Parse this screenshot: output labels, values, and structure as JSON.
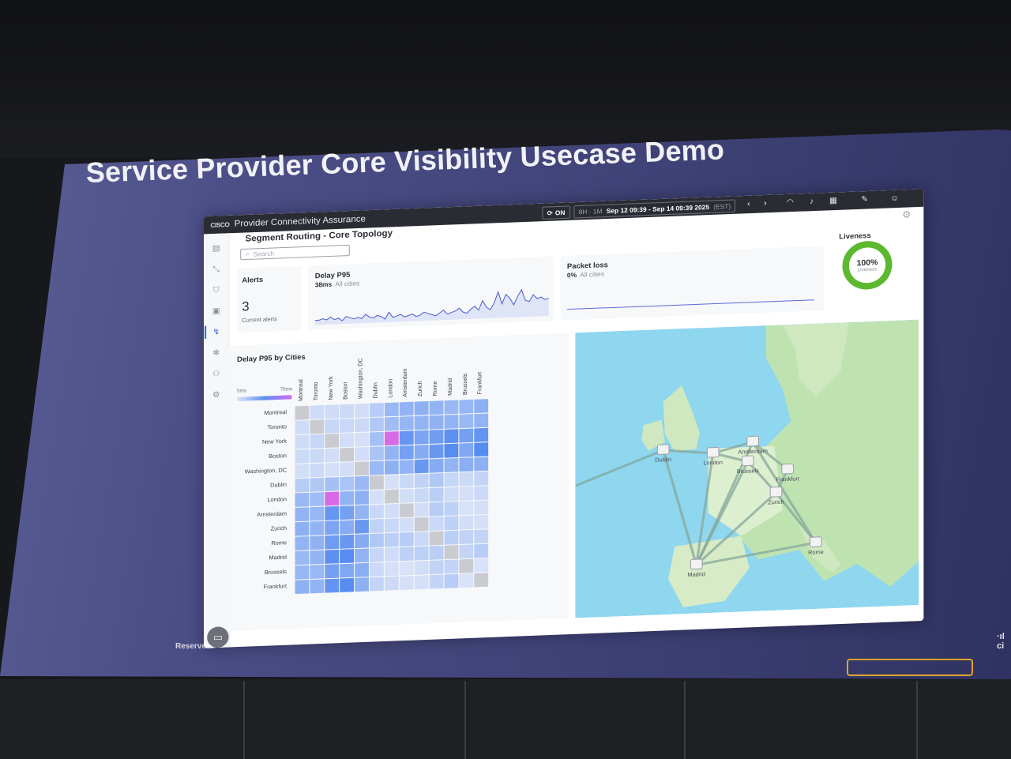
{
  "slide": {
    "title": "Service Provider Core Visibility Usecase Demo",
    "footer": "Reserved."
  },
  "app": {
    "brand": "Provider Connectivity Assurance",
    "logo": "CISCO",
    "live": "ON",
    "range_options": "8H · 1M",
    "range_text": "Sep 12 09:39 - Sep 14 09:39 2025",
    "timezone": "(EST)"
  },
  "page": {
    "title": "Segment Routing - Core Topology",
    "search_placeholder": "Search"
  },
  "alerts": {
    "title": "Alerts",
    "count": "3",
    "caption": "Current alerts"
  },
  "delay": {
    "title": "Delay P95",
    "value": "38ms",
    "scope": "All cities",
    "series": [
      8,
      8,
      9,
      8,
      10,
      8,
      9,
      7,
      10,
      9,
      8,
      9,
      8,
      11,
      9,
      8,
      10,
      9,
      7,
      12,
      8,
      9,
      10,
      8,
      9,
      10,
      8,
      9,
      11,
      10,
      9,
      8,
      10,
      12,
      9,
      10,
      11,
      13,
      10,
      9,
      12,
      14,
      11,
      18,
      13,
      11,
      16,
      24,
      15,
      22,
      19,
      14,
      20,
      25,
      17,
      16,
      21,
      18,
      19,
      17,
      18
    ]
  },
  "packet_loss": {
    "title": "Packet loss",
    "value": "0%",
    "scope": "All cities"
  },
  "liveness": {
    "title": "Liveness",
    "value": "100%",
    "caption": "Liveness",
    "fraction": 1.0,
    "color": "#5cb82e"
  },
  "heatmap": {
    "title": "Delay P95 by Cities",
    "legend_min": "5ms",
    "legend_max": "70ms",
    "cities": [
      "Montreal",
      "Toronto",
      "New York",
      "Boston",
      "Washington, DC",
      "Dublin",
      "London",
      "Amsterdam",
      "Zurich",
      "Rome",
      "Madrid",
      "Brussels",
      "Frankfurt"
    ],
    "columns": [
      "Montreal",
      "Toronto",
      "New York",
      "Boston",
      "Washington, DC",
      "Dublin",
      "London",
      "Amsterdam",
      "Zurich",
      "Rome",
      "Madrid",
      "Brussels",
      "Frankfurt"
    ],
    "values": [
      [
        0,
        10,
        10,
        11,
        9,
        18,
        28,
        30,
        32,
        30,
        28,
        29,
        32
      ],
      [
        10,
        0,
        13,
        12,
        11,
        20,
        26,
        29,
        30,
        31,
        30,
        28,
        30
      ],
      [
        10,
        13,
        0,
        9,
        8,
        24,
        70,
        45,
        38,
        42,
        48,
        40,
        46
      ],
      [
        11,
        12,
        9,
        0,
        9,
        22,
        30,
        40,
        34,
        44,
        52,
        36,
        50
      ],
      [
        9,
        11,
        8,
        9,
        0,
        28,
        32,
        30,
        44,
        34,
        30,
        33,
        32
      ],
      [
        18,
        20,
        24,
        22,
        28,
        0,
        8,
        12,
        15,
        20,
        13,
        11,
        14
      ],
      [
        28,
        26,
        70,
        30,
        32,
        8,
        0,
        9,
        12,
        17,
        10,
        8,
        11
      ],
      [
        30,
        29,
        45,
        40,
        30,
        12,
        9,
        0,
        9,
        18,
        16,
        7,
        8
      ],
      [
        32,
        30,
        38,
        34,
        44,
        15,
        12,
        9,
        0,
        12,
        16,
        9,
        8
      ],
      [
        30,
        31,
        42,
        44,
        34,
        20,
        17,
        18,
        12,
        0,
        17,
        15,
        14
      ],
      [
        28,
        30,
        48,
        52,
        30,
        13,
        10,
        16,
        16,
        17,
        0,
        14,
        18
      ],
      [
        29,
        28,
        40,
        36,
        33,
        11,
        8,
        7,
        9,
        15,
        14,
        0,
        7
      ],
      [
        32,
        30,
        46,
        50,
        32,
        14,
        11,
        8,
        8,
        14,
        18,
        7,
        0
      ]
    ]
  },
  "map": {
    "nodes": [
      {
        "name": "Dublin"
      },
      {
        "name": "London"
      },
      {
        "name": "Amsterdam"
      },
      {
        "name": "Brussels"
      },
      {
        "name": "Frankfurt"
      },
      {
        "name": "Zurich"
      },
      {
        "name": "Rome"
      },
      {
        "name": "Madrid"
      }
    ],
    "links": [
      [
        "Dublin",
        "London"
      ],
      [
        "Dublin",
        "Madrid"
      ],
      [
        "London",
        "Amsterdam"
      ],
      [
        "London",
        "Brussels"
      ],
      [
        "London",
        "Madrid"
      ],
      [
        "Amsterdam",
        "Frankfurt"
      ],
      [
        "Amsterdam",
        "Madrid"
      ],
      [
        "Brussels",
        "Zurich"
      ],
      [
        "Frankfurt",
        "Zurich"
      ],
      [
        "Zurich",
        "Rome"
      ],
      [
        "Zurich",
        "Madrid"
      ],
      [
        "Madrid",
        "Rome"
      ],
      [
        "Brussels",
        "Madrid"
      ],
      [
        "Amsterdam",
        "Rome"
      ]
    ]
  }
}
